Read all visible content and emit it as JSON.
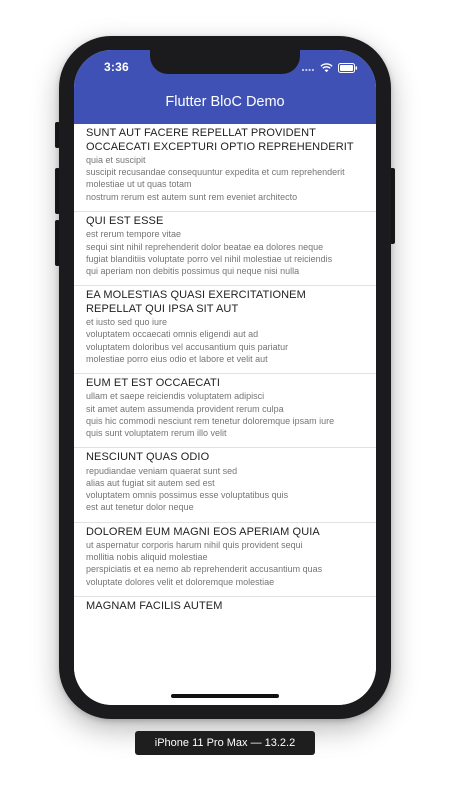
{
  "status_bar": {
    "time": "3:36",
    "icons": [
      "signal-dots-icon",
      "wifi-icon",
      "battery-icon"
    ]
  },
  "app_bar": {
    "title": "Flutter BloC Demo",
    "color": "#3f51b5"
  },
  "posts": [
    {
      "title": "SUNT AUT FACERE REPELLAT PROVIDENT OCCAECATI EXCEPTURI OPTIO REPREHENDERIT",
      "body": "quia et suscipit\nsuscipit recusandae consequuntur expedita et cum reprehenderit molestiae ut ut quas totam\nnostrum rerum est autem sunt rem eveniet architecto"
    },
    {
      "title": "QUI EST ESSE",
      "body": "est rerum tempore vitae\nsequi sint nihil reprehenderit dolor beatae ea dolores neque\nfugiat blanditiis voluptate porro vel nihil molestiae ut reiciendis\nqui aperiam non debitis possimus qui neque nisi nulla"
    },
    {
      "title": "EA MOLESTIAS QUASI EXERCITATIONEM REPELLAT QUI IPSA SIT AUT",
      "body": "et iusto sed quo iure\nvoluptatem occaecati omnis eligendi aut ad\nvoluptatem doloribus vel accusantium quis pariatur\nmolestiae porro eius odio et labore et velit aut"
    },
    {
      "title": "EUM ET EST OCCAECATI",
      "body": "ullam et saepe reiciendis voluptatem adipisci\nsit amet autem assumenda provident rerum culpa\nquis hic commodi nesciunt rem tenetur doloremque ipsam iure\nquis sunt voluptatem rerum illo velit"
    },
    {
      "title": "NESCIUNT QUAS ODIO",
      "body": "repudiandae veniam quaerat sunt sed\nalias aut fugiat sit autem sed est\nvoluptatem omnis possimus esse voluptatibus quis\nest aut tenetur dolor neque"
    },
    {
      "title": "DOLOREM EUM MAGNI EOS APERIAM QUIA",
      "body": "ut aspernatur corporis harum nihil quis provident sequi\nmollitia nobis aliquid molestiae\nperspiciatis et ea nemo ab reprehenderit accusantium quas\nvoluptate dolores velit et doloremque molestiae"
    },
    {
      "title": "MAGNAM FACILIS AUTEM",
      "body": ""
    }
  ],
  "device_label": "iPhone 11 Pro Max — 13.2.2"
}
